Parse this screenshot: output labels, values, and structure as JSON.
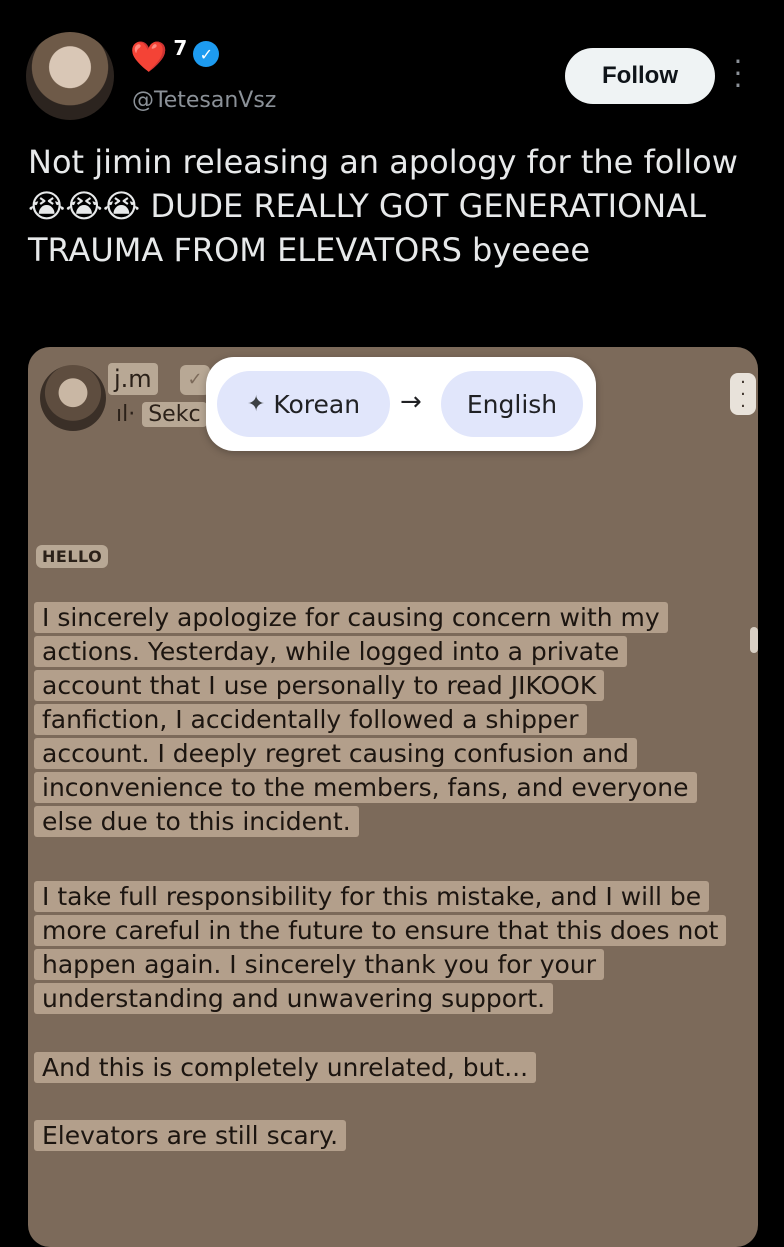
{
  "tweet": {
    "display_name_emoji": "❤️",
    "display_name_number": "7",
    "handle": "@TetesanVsz",
    "follow_label": "Follow",
    "text": "Not jimin releasing an apology for the follow 😭😭😭 DUDE REALLY GOT GENERATIONAL TRAUMA FROM ELEVATORS byeeee"
  },
  "media": {
    "username": "j.m",
    "subtitle": "Sekc",
    "translate": {
      "source": "Korean",
      "target": "English",
      "sparkle_icon": "sparkle-icon",
      "arrow_icon": "arrow-right-icon"
    },
    "hello_label": "HELLO",
    "paragraphs": [
      "I sincerely apologize for causing concern with my actions. Yesterday, while logged into a private account that I use personally to read JIKOOK fanfiction, I accidentally followed a shipper account. I deeply regret causing confusion and inconvenience to the members, fans, and everyone else due to this incident.",
      "I take full responsibility for this mistake, and I will be more careful in the future to ensure that this does not happen again. I sincerely thank you for your understanding and unwavering support.",
      "And this is completely unrelated, but...",
      "Elevators are still scary."
    ]
  },
  "colors": {
    "background": "#000000",
    "verified_blue": "#1d9bf0",
    "heart_red": "#f4374f",
    "media_brown": "#7c6a5a"
  }
}
